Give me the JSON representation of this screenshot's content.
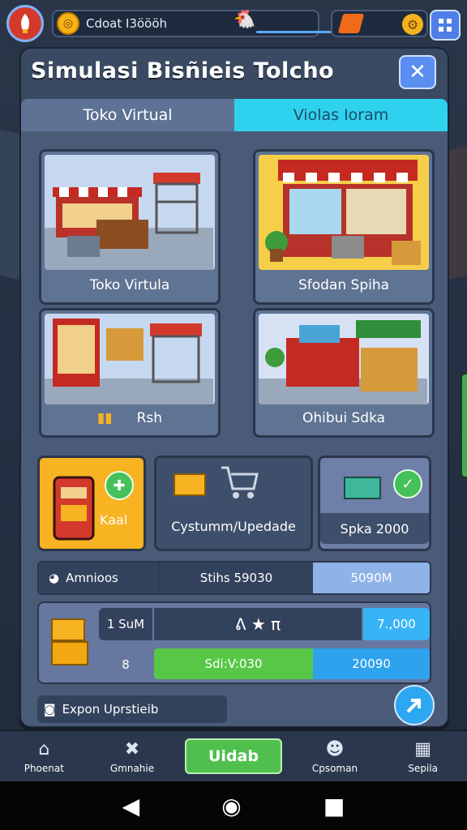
{
  "hud": {
    "coin_text": "Cdoat I3öööh",
    "menu_icon": "grid-icon"
  },
  "panel": {
    "title": "Simulasi Bisñieis Tolcho",
    "close_label": "✕",
    "tabs": [
      {
        "label": "Toko Virtual",
        "active": false
      },
      {
        "label": "Violas Ioram",
        "active": true
      }
    ]
  },
  "cards": [
    {
      "label": "Toko Virtula"
    },
    {
      "label": "Sfodan Spiha"
    },
    {
      "label": "Rsh"
    },
    {
      "label": "Ohibui Sdka"
    }
  ],
  "tiles": [
    {
      "label": "Kaal"
    },
    {
      "label": "Cystumm/Upedade"
    },
    {
      "label": "Spka 2000"
    }
  ],
  "row1": {
    "a": "Amnioos",
    "b": "Stihs 59030",
    "c": "5090M"
  },
  "row2": {
    "a": "1 SuM",
    "b": "ᕕ ★ π",
    "c": "7.,000"
  },
  "row3": {
    "a": "8",
    "b": "Sdi:V:030",
    "c": "20090"
  },
  "expand_label": "Expon Uprstieib",
  "nav": [
    {
      "label": "Phoenat",
      "icon": "home-icon"
    },
    {
      "label": "Gmnahie",
      "icon": "tools-icon"
    },
    {
      "label": "Uidab",
      "icon": ""
    },
    {
      "label": "Cpsoman",
      "icon": "worker-icon"
    },
    {
      "label": "Sepila",
      "icon": "calendar-icon"
    }
  ],
  "colors": {
    "accent": "#2fd2ee",
    "gold": "#f7b321",
    "green": "#4fc04e",
    "blue": "#2ea7f2"
  }
}
